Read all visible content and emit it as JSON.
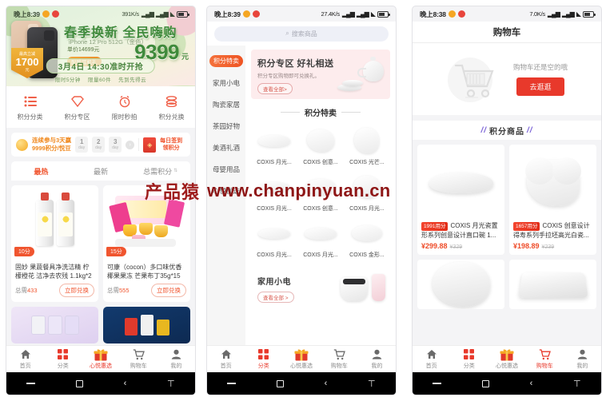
{
  "phone1": {
    "status": {
      "time": "晚上8:39",
      "speed": "391K/s",
      "signal_icon": "signal-icon",
      "wifi_icon": "wifi-icon",
      "battery_icon": "battery-icon"
    },
    "banner": {
      "title": "春季换新 全民嗨购",
      "subtitle": "iPhone 12 Pro 512G（金色）",
      "orig_label": "单价14699元",
      "badge": "配赠耳机礼",
      "price": "9399",
      "unit": "元",
      "tag_top": "最高立减",
      "tag_num": "1700",
      "tag_bottom": "元",
      "time_line": "3月4日  14:30准时开抢",
      "notes": [
        "限时5分钟",
        "限量60件",
        "先到先得云"
      ]
    },
    "quick_icons": [
      {
        "icon": "list-icon",
        "label": "积分分类"
      },
      {
        "icon": "diamond-icon",
        "label": "积分专区"
      },
      {
        "icon": "alarm-icon",
        "label": "限时秒拍"
      },
      {
        "icon": "coins-icon",
        "label": "积分兑换"
      }
    ],
    "signin": {
      "line1": "连续参与3天赢",
      "line2": "9999积分/悦豆",
      "days": [
        {
          "n": "1",
          "u": "day"
        },
        {
          "n": "2",
          "u": "day"
        },
        {
          "n": "3",
          "u": "day"
        }
      ],
      "arrow": "›",
      "right_line1": "每日签到",
      "right_line2": "领积分"
    },
    "tabs": [
      {
        "label": "最热",
        "active": true
      },
      {
        "label": "最新",
        "active": false
      },
      {
        "label": "总需积分",
        "active": false,
        "sort": "⇅"
      }
    ],
    "products": [
      {
        "badge": "10分",
        "name": "固妙 果蔬餐具净洗洁精 柠檬橙花 洁净去农残 1.1kg*2",
        "points_prefix": "总需",
        "points": "433",
        "button": "立即兑换"
      },
      {
        "badge": "15分",
        "name": "可康（cocon）多口味优香椰果果冻 芒果布丁35g*15杯*...",
        "points_prefix": "总需",
        "points": "555",
        "button": "立即兑换"
      }
    ],
    "tabbar": [
      {
        "icon": "home-icon",
        "label": "首页",
        "active": false
      },
      {
        "icon": "grid-icon",
        "label": "分类",
        "active": false
      },
      {
        "icon": "gift-icon",
        "label": "心悦惠选",
        "active": true
      },
      {
        "icon": "cart-icon",
        "label": "购物车",
        "active": false
      },
      {
        "icon": "user-icon",
        "label": "我的",
        "active": false
      }
    ],
    "navbar": [
      "recent-apps-icon",
      "home-square-icon",
      "back-icon",
      "assistant-icon"
    ]
  },
  "phone2": {
    "status": {
      "time": "晚上8:39",
      "speed": "27.4K/s"
    },
    "search": {
      "placeholder": "搜索商品",
      "icon": "search-icon"
    },
    "sidebar": [
      {
        "label": "积分特卖",
        "active": true
      },
      {
        "label": "家用小电",
        "active": false
      },
      {
        "label": "陶瓷家居",
        "active": false
      },
      {
        "label": "茶园好物",
        "active": false
      },
      {
        "label": "美酒礼酒",
        "active": false
      },
      {
        "label": "母婴用品",
        "active": false
      },
      {
        "label": "心悦优选",
        "active": false
      }
    ],
    "promo": {
      "title": "积分专区 好礼相送",
      "subtitle": "积分专区购物即可兑换礼。",
      "button": "查看全部>"
    },
    "section_title": "积分特卖",
    "grid": [
      {
        "name": "COXIS 月光..."
      },
      {
        "name": "COXIS 创意..."
      },
      {
        "name": "COXIS 光芒..."
      },
      {
        "name": "COXIS 月光..."
      },
      {
        "name": "COXIS 创意..."
      },
      {
        "name": "COXIS 月光..."
      },
      {
        "name": "COXIS 月光..."
      },
      {
        "name": "COXIS 月光..."
      },
      {
        "name": "COXIS 金形..."
      }
    ],
    "bottom": {
      "title": "家用小电",
      "button": "查看全部 >"
    },
    "tabbar": [
      {
        "icon": "home-icon",
        "label": "首页",
        "active": false
      },
      {
        "icon": "grid-icon",
        "label": "分类",
        "active": true
      },
      {
        "icon": "gift-icon",
        "label": "心悦惠选",
        "active": false
      },
      {
        "icon": "cart-icon",
        "label": "购物车",
        "active": false
      },
      {
        "icon": "user-icon",
        "label": "我的",
        "active": false
      }
    ]
  },
  "phone3": {
    "status": {
      "time": "晚上8:38",
      "speed": "7.0K/s"
    },
    "title": "购物车",
    "empty": {
      "text": "购物车还是空的哦",
      "button": "去逛逛",
      "icon": "empty-cart-icon"
    },
    "section_title": "积分商品",
    "section_mark": "//",
    "products": [
      {
        "badge": "1991用分",
        "name_line1": "COXIS 月光瓷置",
        "name_line2": "形系列创意设计直口碗 1...",
        "price": "¥299.88",
        "old_price": "¥329"
      },
      {
        "badge": "1657用分",
        "name_line1": "COXIS 创意设计",
        "name_line2": "得寿系列手拉坯高光白瓷...",
        "price": "¥198.89",
        "old_price": "¥239"
      }
    ],
    "tabbar": [
      {
        "icon": "home-icon",
        "label": "首页",
        "active": false
      },
      {
        "icon": "grid-icon",
        "label": "分类",
        "active": false
      },
      {
        "icon": "gift-icon",
        "label": "心悦惠选",
        "active": false
      },
      {
        "icon": "cart-icon",
        "label": "购物车",
        "active": true
      },
      {
        "icon": "user-icon",
        "label": "我的",
        "active": false
      }
    ]
  },
  "watermark": {
    "cn": "产品猿",
    "url": "www.chanpinyuan.cn"
  }
}
